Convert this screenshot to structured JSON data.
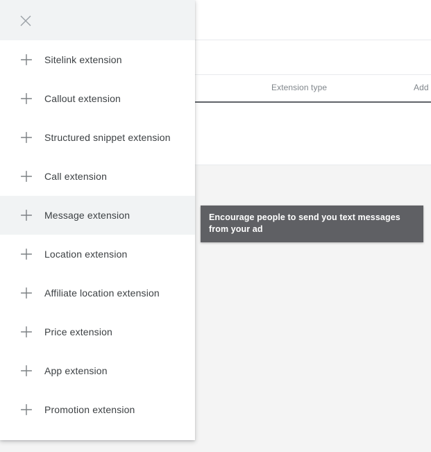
{
  "background": {
    "table": {
      "columns": [
        {
          "id": "extension-type",
          "label": "Extension type"
        },
        {
          "id": "add",
          "label": "Add"
        }
      ]
    }
  },
  "tooltip": {
    "text": "Encourage people to send you text messages from your ad",
    "background_color": "#5f6064",
    "text_color": "#ffffff"
  },
  "panel": {
    "close_icon": "close-icon",
    "header_background": "#f1f3f4",
    "hover_background": "#f1f3f4",
    "items": [
      {
        "icon": "plus-icon",
        "label": "Sitelink extension",
        "hovered": false
      },
      {
        "icon": "plus-icon",
        "label": "Callout extension",
        "hovered": false
      },
      {
        "icon": "plus-icon",
        "label": "Structured snippet extension",
        "hovered": false
      },
      {
        "icon": "plus-icon",
        "label": "Call extension",
        "hovered": false
      },
      {
        "icon": "plus-icon",
        "label": "Message extension",
        "hovered": true
      },
      {
        "icon": "plus-icon",
        "label": "Location extension",
        "hovered": false
      },
      {
        "icon": "plus-icon",
        "label": "Affiliate location extension",
        "hovered": false
      },
      {
        "icon": "plus-icon",
        "label": "Price extension",
        "hovered": false
      },
      {
        "icon": "plus-icon",
        "label": "App extension",
        "hovered": false
      },
      {
        "icon": "plus-icon",
        "label": "Promotion extension",
        "hovered": false
      }
    ]
  }
}
